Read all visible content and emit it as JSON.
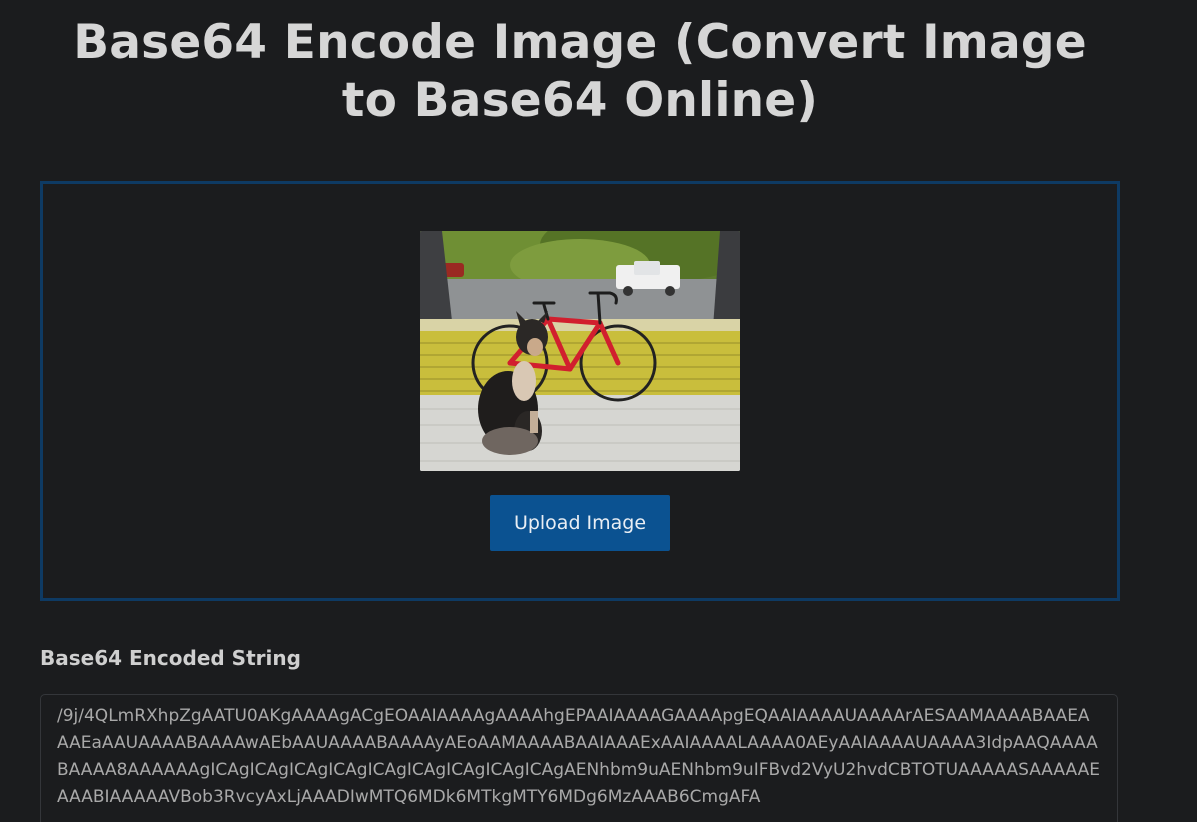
{
  "page": {
    "title": "Base64 Encode Image (Convert Image to Base64 Online)"
  },
  "uploader": {
    "upload_button_label": "Upload Image",
    "preview_image": "photo-dog-and-red-bicycle-on-porch"
  },
  "output": {
    "label": "Base64 Encoded String",
    "value": "/9j/4QLmRXhpZgAATU0AKgAAAAgACgEOAAIAAAAgAAAAhgEPAAIAAAAGAAAApgEQAAIAAAAUAAAArAESAAMAAAABAAEAAAEaAAUAAAABAAAAwAEbAAUAAAABAAAAyAEoAAMAAAABAAIAAAExAAIAAAALAAAA0AEyAAIAAAAUAAAA3IdpAAQAAAABAAAA8AAAAAAgICAgICAgICAgICAgICAgICAgICAgICAgICAgAENhbm9uAENhbm9uIFBvd2VyU2hvdCBTOTUAAAAASAAAAAEAAABIAAAAAVBob3RvcyAxLjAAADIwMTQ6MDk6MTkgMTY6MDg6MzAAAB6CmgAFA"
  },
  "colors": {
    "background": "#1b1c1e",
    "dropzone_border": "#0e3a63",
    "button": "#0b5291",
    "title_text": "#d6d6d6"
  }
}
